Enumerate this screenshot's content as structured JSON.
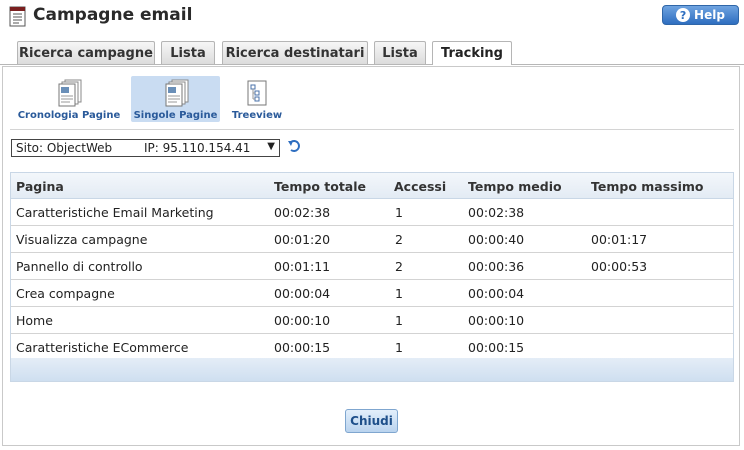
{
  "header": {
    "title": "Campagne email",
    "help_label": "Help"
  },
  "tabs": [
    {
      "label": "Ricerca campagne"
    },
    {
      "label": "Lista"
    },
    {
      "label": "Ricerca destinatari"
    },
    {
      "label": "Lista"
    },
    {
      "label": "Tracking",
      "active": true
    }
  ],
  "subtabs": [
    {
      "label": "Cronologia Pagine",
      "icon": "document-stack-icon"
    },
    {
      "label": "Singole Pagine",
      "icon": "document-stack-icon",
      "active": true
    },
    {
      "label": "Treeview",
      "icon": "treeview-icon"
    }
  ],
  "filter": {
    "site_label": "Sito: ObjectWeb",
    "ip_label": "IP: 95.110.154.41"
  },
  "table": {
    "columns": [
      "Pagina",
      "Tempo totale",
      "Accessi",
      "Tempo medio",
      "Tempo massimo"
    ],
    "rows": [
      [
        "Caratteristiche Email Marketing",
        "00:02:38",
        "1",
        "00:02:38",
        ""
      ],
      [
        "Visualizza campagne",
        "00:01:20",
        "2",
        "00:00:40",
        "00:01:17"
      ],
      [
        "Pannello di controllo",
        "00:01:11",
        "2",
        "00:00:36",
        "00:00:53"
      ],
      [
        "Crea compagne",
        "00:00:04",
        "1",
        "00:00:04",
        ""
      ],
      [
        "Home",
        "00:00:10",
        "1",
        "00:00:10",
        ""
      ],
      [
        "Caratteristiche ECommerce",
        "00:00:15",
        "1",
        "00:00:15",
        ""
      ]
    ]
  },
  "footer": {
    "close_label": "Chiudi"
  },
  "colors": {
    "accent": "#2e6ec0",
    "grid_header": "#e3ebf4",
    "active_subtab": "#c9dcf2"
  }
}
